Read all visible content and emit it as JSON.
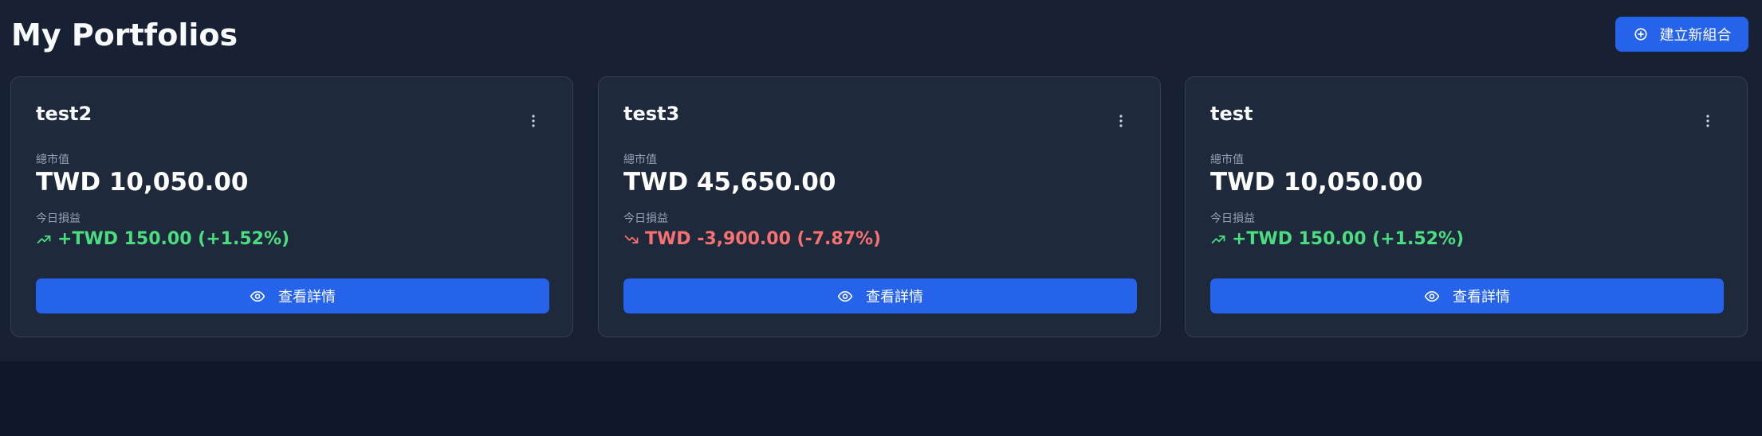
{
  "page": {
    "title": "My Portfolios"
  },
  "actions": {
    "create_label": "建立新組合",
    "create_icon": "plus-circle-icon"
  },
  "labels": {
    "market_value": "總市值",
    "today_pnl": "今日損益",
    "view_details": "查看詳情"
  },
  "icons": {
    "more": "vertical-dots-icon",
    "view": "eye-icon",
    "up": "trending-up-icon",
    "down": "trending-down-icon"
  },
  "colors": {
    "background": "#0f172a",
    "panel": "#172133",
    "card": "#1e293b",
    "accent": "#2563eb",
    "positive": "#4ade80",
    "negative": "#f87171",
    "muted": "#94a3b8"
  },
  "portfolios": [
    {
      "name": "test2",
      "market_value": "TWD 10,050.00",
      "today_pnl": "+TWD 150.00 (+1.52%)",
      "trend": "up"
    },
    {
      "name": "test3",
      "market_value": "TWD 45,650.00",
      "today_pnl": "TWD -3,900.00 (-7.87%)",
      "trend": "down"
    },
    {
      "name": "test",
      "market_value": "TWD 10,050.00",
      "today_pnl": "+TWD 150.00 (+1.52%)",
      "trend": "up"
    }
  ]
}
